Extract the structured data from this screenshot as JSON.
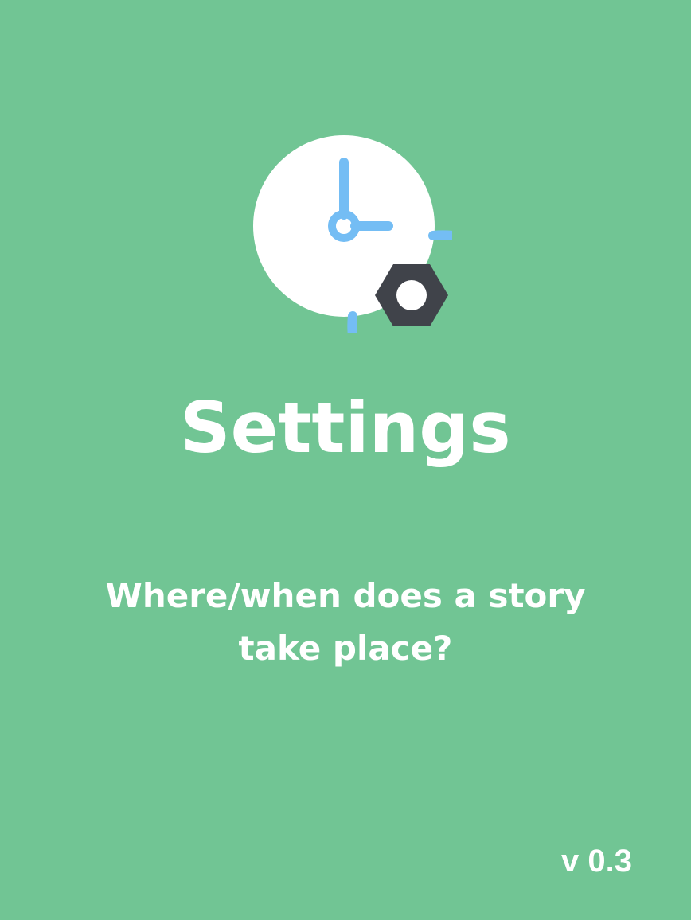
{
  "screen": {
    "background_color": "#71c594",
    "icon": {
      "name": "clock-settings-icon",
      "ring_color": "#74bdf4",
      "face_color": "#ffffff",
      "hands_color": "#74bdf4",
      "nut_color": "#40434a"
    },
    "title": "Settings",
    "subtitle": "Where/when does a story take place?",
    "version": "v 0.3"
  }
}
